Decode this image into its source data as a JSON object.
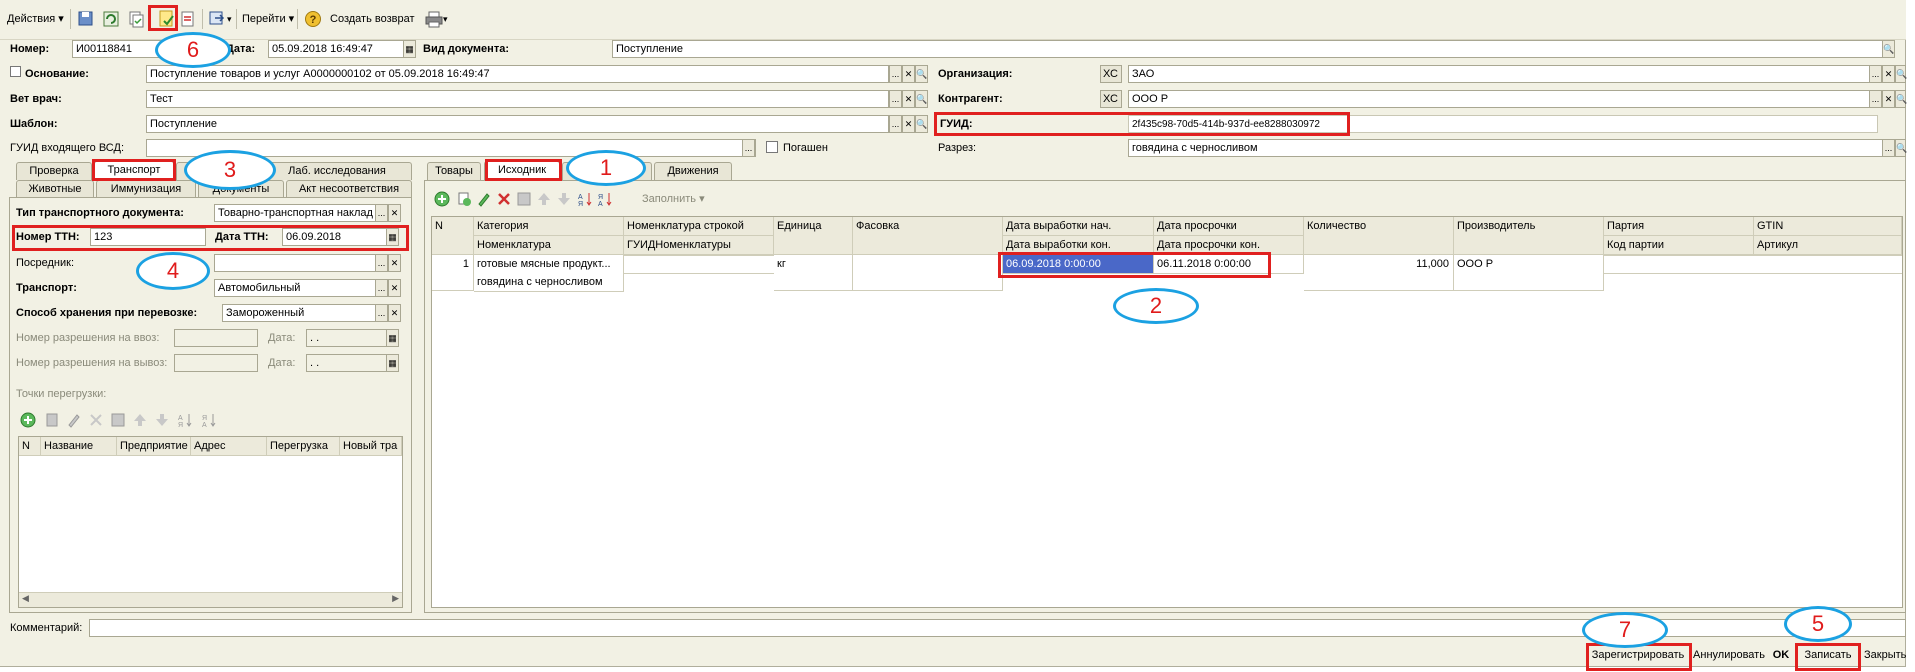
{
  "toolbar": {
    "actions": "Действия",
    "goto": "Перейти",
    "create_return": "Создать возврат"
  },
  "header": {
    "number_label": "Номер:",
    "number_value": "И00118841",
    "date_label": "Дата:",
    "date_value": "05.09.2018 16:49:47",
    "doc_type_label": "Вид документа:",
    "doc_type_value": "Поступление",
    "basis_label": "Основание:",
    "basis_value": "Поступление товаров и услуг А0000000102 от 05.09.2018 16:49:47",
    "org_label": "Организация:",
    "org_code": "ХС",
    "org_value": "ЗАО",
    "vet_label": "Вет врач:",
    "vet_value": "Тест",
    "contractor_label": "Контрагент:",
    "contractor_code": "ХС",
    "contractor_value": "ООО Р",
    "template_label": "Шаблон:",
    "template_value": "Поступление",
    "guid_label": "ГУИД:",
    "guid_value": "2f435c98-70d5-414b-937d-ee8288030972",
    "vsd_guid_label": "ГУИД входящего ВСД:",
    "vsd_guid_value": "",
    "repaid_label": "Погашен",
    "cut_label": "Разрез:",
    "cut_value": "говядина с черносливом"
  },
  "left_tabs": {
    "row1": [
      "Проверка",
      "Транспорт",
      "",
      "Лаб. исследования"
    ],
    "row2": [
      "Животные",
      "Иммунизация",
      "Документы",
      "Акт несоответствия"
    ]
  },
  "transport": {
    "doc_type_label": "Тип транспортного документа:",
    "doc_type_value": "Товарно-транспортная наклад",
    "ttn_number_label": "Номер ТТН:",
    "ttn_number_value": "123",
    "ttn_date_label": "Дата ТТН:",
    "ttn_date_value": "06.09.2018",
    "broker_label": "Посредник:",
    "broker_value": "",
    "transport_label": "Транспорт:",
    "transport_value": "Автомобильный",
    "storage_label": "Способ хранения при перевозке:",
    "storage_value": "Замороженный",
    "import_permit_label": "Номер разрешения на ввоз:",
    "export_permit_label": "Номер разрешения на вывоз:",
    "date_label": "Дата:",
    "date_placeholder": " .  .",
    "reload_points_label": "Точки перегрузки:",
    "grid_headers": [
      "N",
      "Название",
      "Предприятие",
      "Адрес",
      "Перегрузка",
      "Новый тра"
    ]
  },
  "right_tabs": [
    "Товары",
    "Исходник",
    "",
    "Движения"
  ],
  "right_toolbar": {
    "fill_label": "Заполнить"
  },
  "goods_grid": {
    "headers_top": [
      "N",
      "Категория",
      "Номенклатура строкой",
      "Единица",
      "Фасовка",
      "Дата выработки нач.",
      "Дата просрочки",
      "Количество",
      "Производитель",
      "Партия",
      "GTIN"
    ],
    "headers_bottom": [
      "",
      "Номенклатура",
      "ГУИДНоменклатуры",
      "",
      "",
      "Дата выработки кон.",
      "Дата просрочки кон.",
      "",
      "",
      "Код партии",
      "Артикул"
    ],
    "rows": [
      {
        "n": "1",
        "category": "готовые мясные продукт...",
        "nomenclature": "говядина с черносливом",
        "unit": "кг",
        "prod_start": "06.09.2018 0:00:00",
        "expiry": "06.11.2018 0:00:00",
        "quantity": "11,000",
        "manufacturer": "ООО Р"
      }
    ]
  },
  "comment_label": "Комментарий:",
  "buttons": {
    "register": "Зарегистрировать",
    "annul": "Аннулировать",
    "ok": "OK",
    "save": "Записать",
    "close": "Закрыть"
  },
  "annotations": [
    "1",
    "2",
    "3",
    "4",
    "5",
    "6",
    "7"
  ],
  "colors": {
    "window_bg": "#f2f1e4",
    "annotation_red": "#e0201f",
    "annotation_blue": "#1ba1e2",
    "selection": "#3c64c8"
  }
}
